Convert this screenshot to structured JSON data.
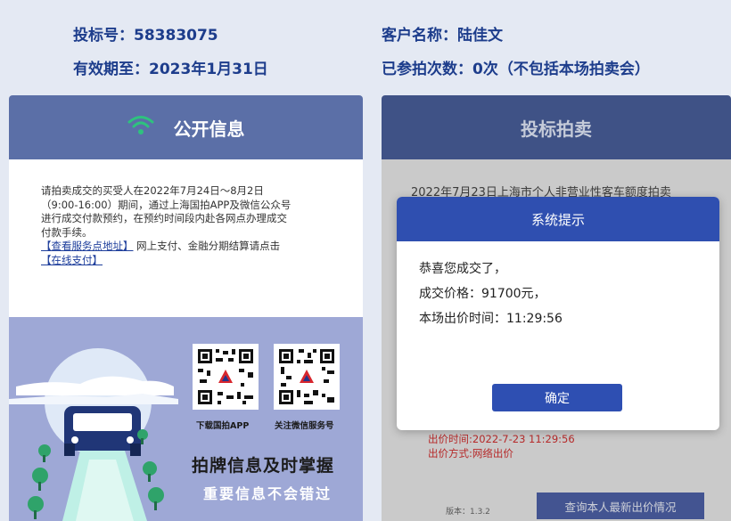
{
  "header": {
    "bid_number": "投标号：58383075",
    "valid_until": "有效期至：2023年1月31日",
    "customer_name": "客户名称：陆佳文",
    "participation_count": "已参拍次数：0次（不包括本场拍卖会）"
  },
  "left_panel": {
    "title": "公开信息",
    "icon": "wifi-icon",
    "notice_lines": [
      "请拍卖成交的买受人在2022年7月24日～8月2日",
      "（9:00-16:00）期间，通过上海国拍APP及微信公众号",
      "进行成交付款预约，在预约时间段内赴各网点办理成交",
      "付款手续。"
    ],
    "service_link": "【查看服务点地址】",
    "payment_text": "网上支付、金融分期结算请点击",
    "online_pay_link": "【在线支付】",
    "banner": {
      "qr1_label": "下载国拍APP",
      "qr2_label": "关注微信服务号",
      "slogan": "拍牌信息及时掌握",
      "subslogan": "重要信息不会错过"
    }
  },
  "right_panel": {
    "title": "投标拍卖",
    "auction_name": "2022年7月23日上海市个人非营业性客车额度拍卖",
    "bid_time": "出价时间:2022-7-23 11:29:56",
    "bid_method": "出价方式:网络出价",
    "version": "版本：1.3.2",
    "query_button": "查询本人最新出价情况"
  },
  "modal": {
    "title": "系统提示",
    "line1": "恭喜您成交了，",
    "line2": "成交价格：91700元，",
    "line3": "本场出价时间：11:29:56",
    "ok_button": "确定"
  },
  "colors": {
    "header_text": "#1d3d8c",
    "left_title_bg": "#5b6fa7",
    "right_title_bg": "#3f5286",
    "modal_accent": "#2f4fb0",
    "wifi_green": "#2ec27e",
    "red_text": "#d03030"
  }
}
